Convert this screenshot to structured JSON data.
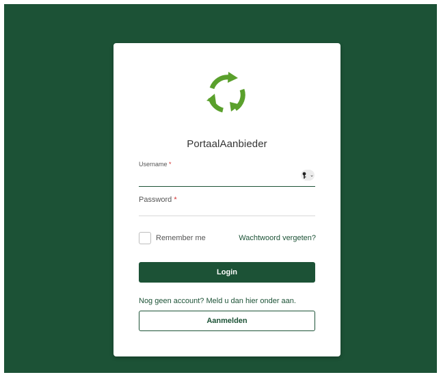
{
  "app": {
    "title": "PortaalAanbieder",
    "logo_icon": "recycle-arrows-icon"
  },
  "colors": {
    "brand": "#1c5236",
    "logo_green": "#5aa02c",
    "required": "#d32f2f"
  },
  "form": {
    "username_label": "Username",
    "username_value": "",
    "password_label": "Password",
    "password_value": "",
    "required_marker": "*",
    "key_icon": "key-icon",
    "remember_label": "Remember me",
    "remember_checked": false,
    "forgot_link": "Wachtwoord vergeten?",
    "login_button": "Login"
  },
  "register": {
    "prompt": "Nog geen account? Meld u dan hier onder aan.",
    "button": "Aanmelden"
  }
}
